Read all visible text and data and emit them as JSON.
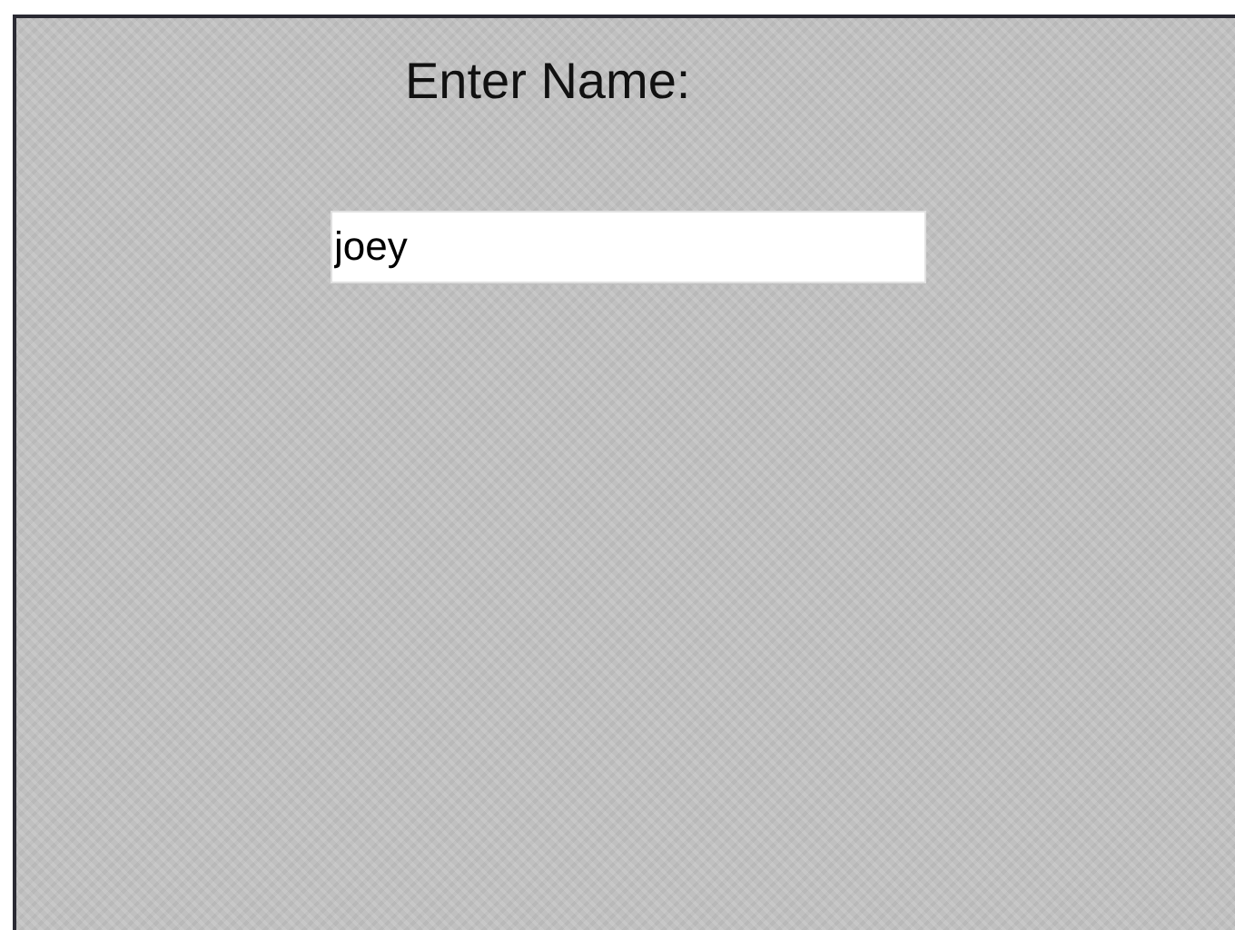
{
  "prompt": {
    "title": "Enter Name:"
  },
  "name_field": {
    "value": "joey"
  }
}
